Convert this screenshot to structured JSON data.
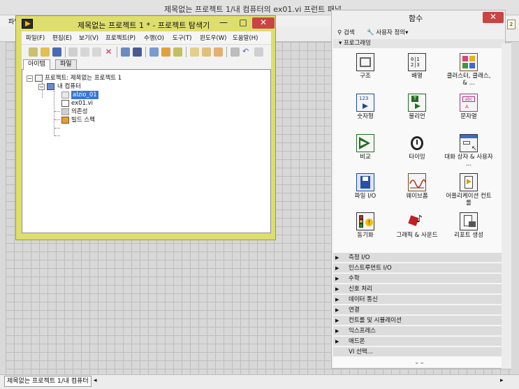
{
  "bg_window": {
    "title": "제목없는 프로젝트 1/내 컴퓨터의 ex01.vi 프런트 패널",
    "menu_first": "파일",
    "status_text": "제목없는 프로젝트 1/내 컴퓨터",
    "right_mini_label": "2"
  },
  "project_window": {
    "title": "제목없는 프로젝트 1 * - 프로젝트 탐색기",
    "menu": [
      "파일(F)",
      "편집(E)",
      "보기(V)",
      "프로젝트(P)",
      "수행(O)",
      "도구(T)",
      "윈도우(W)",
      "도움말(H)"
    ],
    "tabs": [
      "아이템",
      "파일"
    ],
    "tree": {
      "root": "프로젝트: 제목없는 프로젝트 1",
      "computer": "내 컴퓨터",
      "folder": "alzio_01",
      "vi": "ex01.vi",
      "dependencies": "의존성",
      "build_specs": "빌드 스펙"
    }
  },
  "palette": {
    "title": "함수",
    "search_label": "검색",
    "customize_label": "사용자 정의",
    "open_category": "프로그래밍",
    "items": [
      {
        "label": "구조",
        "icon": "structure-icon"
      },
      {
        "label": "배열",
        "icon": "array-icon"
      },
      {
        "label": "클러스터, 클래스, & ...",
        "icon": "cluster-icon"
      },
      {
        "label": "숫자형",
        "icon": "numeric-icon"
      },
      {
        "label": "불리언",
        "icon": "boolean-icon"
      },
      {
        "label": "문자열",
        "icon": "string-icon"
      },
      {
        "label": "비교",
        "icon": "comparison-icon"
      },
      {
        "label": "타이밍",
        "icon": "timing-icon"
      },
      {
        "label": "대화 상자 & 사용자 ...",
        "icon": "dialog-icon"
      },
      {
        "label": "파일 I/O",
        "icon": "file-io-icon"
      },
      {
        "label": "웨이브폼",
        "icon": "waveform-icon"
      },
      {
        "label": "어플리케이션 컨트롤",
        "icon": "app-control-icon"
      },
      {
        "label": "동기화",
        "icon": "sync-icon"
      },
      {
        "label": "그래픽 & 사운드",
        "icon": "graphics-sound-icon"
      },
      {
        "label": "리포트 생성",
        "icon": "report-icon"
      }
    ],
    "categories": [
      "측정 I/O",
      "인스트루먼트 I/O",
      "수학",
      "신호 처리",
      "데이터 통신",
      "연결",
      "컨트롤 및 시뮬레이션",
      "익스프레스",
      "애드온",
      "VI 선택..."
    ],
    "more_glyph": "⌄⌄"
  },
  "colors": {
    "explorer_frame": "#dede6e",
    "close_button": "#c74545",
    "selection": "#3875d7"
  }
}
